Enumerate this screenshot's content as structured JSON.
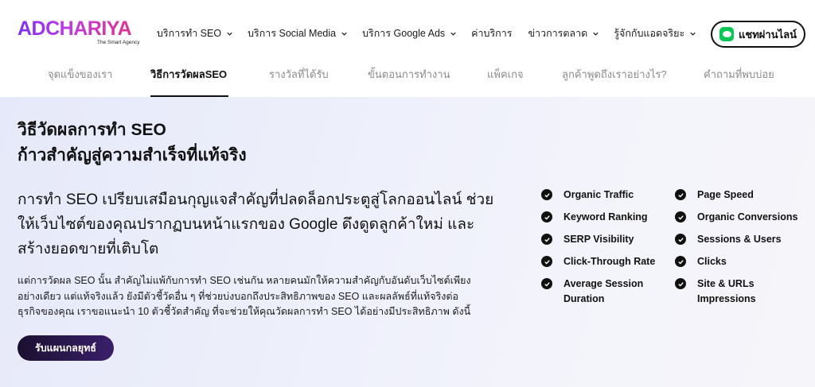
{
  "brand": {
    "name": "ADCHARIYA",
    "tagline": "The Smart Agency",
    "gradient": [
      "#7b2ff7",
      "#e0358f"
    ]
  },
  "nav": {
    "items": [
      {
        "label": "บริการทำ SEO",
        "dropdown": true
      },
      {
        "label": "บริการ Social Media",
        "dropdown": true
      },
      {
        "label": "บริการ Google Ads",
        "dropdown": true
      },
      {
        "label": "ค่าบริการ",
        "dropdown": false
      },
      {
        "label": "ข่าวการตลาด",
        "dropdown": true
      },
      {
        "label": "รู้จักกับแอดจริยะ",
        "dropdown": true
      }
    ],
    "chat_button": "แชทผ่านไลน์"
  },
  "tabs": [
    {
      "label": "จุดแข็งของเรา",
      "active": false
    },
    {
      "label": "วิธีการวัดผลSEO",
      "active": true
    },
    {
      "label": "รางวัลที่ได้รับ",
      "active": false
    },
    {
      "label": "ขั้นตอนการทำงาน",
      "active": false
    },
    {
      "label": "แพ็คเกจ",
      "active": false
    },
    {
      "label": "ลูกค้าพูดถึงเราอย่างไร?",
      "active": false
    },
    {
      "label": "คำถามที่พบบ่อย",
      "active": false
    }
  ],
  "main": {
    "title_line1": "วิธีวัดผลการทำ SEO",
    "title_line2": "ก้าวสำคัญสู่ความสำเร็จที่แท้จริง",
    "lead": "การทำ SEO เปรียบเสมือนกุญแจสำคัญที่ปลดล็อกประตูสู่โลกออนไลน์ ช่วยให้เว็บไซต์ของคุณปรากฏบนหน้าแรกของ Google ดึงดูดลูกค้าใหม่ และสร้างยอดขายที่เติบโต",
    "body": "แต่การวัดผล SEO นั้น สำคัญไม่แพ้กับการทำ SEO เช่นกัน หลายคนมักให้ความสำคัญกับอันดับเว็บไซต์เพียงอย่างเดียว แต่แท้จริงแล้ว ยังมีตัวชี้วัดอื่น ๆ ที่ช่วยบ่งบอกถึงประสิทธิภาพของ SEO และผลลัพธ์ที่แท้จริงต่อธุรกิจของคุณ เราขอแนะนำ 10 ตัวชี้วัดสำคัญ ที่จะช่วยให้คุณวัดผลการทำ SEO ได้อย่างมีประสิทธิภาพ ดังนี้",
    "cta": "รับแผนกลยุทธ์"
  },
  "metrics_left": [
    "Organic Traffic",
    "Keyword Ranking",
    "SERP Visibility",
    "Click-Through Rate",
    "Average Session Duration"
  ],
  "metrics_right": [
    "Page Speed",
    "Organic Conversions",
    "Sessions & Users",
    "Clicks",
    "Site & URLs Impressions"
  ]
}
